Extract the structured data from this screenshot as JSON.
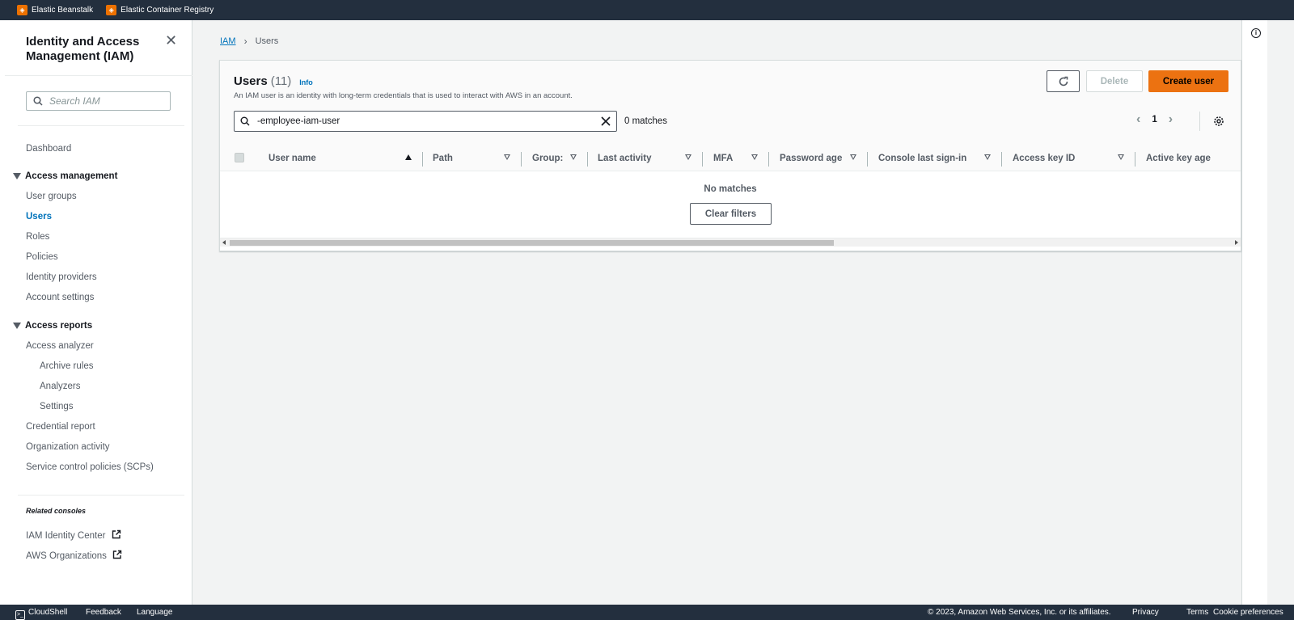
{
  "topbar": {
    "favorites": [
      {
        "label": "Elastic Beanstalk",
        "icon": "elastic-beanstalk-icon"
      },
      {
        "label": "Elastic Container Registry",
        "icon": "ecr-icon"
      }
    ]
  },
  "sidebar": {
    "title": "Identity and Access Management (IAM)",
    "search_placeholder": "Search IAM",
    "dashboard": "Dashboard",
    "access_management": {
      "label": "Access management",
      "items": [
        "User groups",
        "Users",
        "Roles",
        "Policies",
        "Identity providers",
        "Account settings"
      ]
    },
    "access_reports": {
      "label": "Access reports",
      "items": [
        "Access analyzer",
        "Archive rules",
        "Analyzers",
        "Settings",
        "Credential report",
        "Organization activity",
        "Service control policies (SCPs)"
      ]
    },
    "related_title": "Related consoles",
    "related": [
      "IAM Identity Center",
      "AWS Organizations"
    ]
  },
  "breadcrumb": {
    "root": "IAM",
    "current": "Users"
  },
  "users_panel": {
    "title": "Users",
    "count": "(11)",
    "info": "Info",
    "description": "An IAM user is an identity with long-term credentials that is used to interact with AWS in an account.",
    "delete_label": "Delete",
    "create_label": "Create user",
    "filter_value": "-employee-iam-user",
    "matches": "0 matches",
    "page": "1",
    "columns": [
      "User name",
      "Path",
      "Group:",
      "Last activity",
      "MFA",
      "Password age",
      "Console last sign-in",
      "Access key ID",
      "Active key age"
    ],
    "no_matches": "No matches",
    "clear_filters": "Clear filters"
  },
  "footer": {
    "cloudshell": "CloudShell",
    "feedback": "Feedback",
    "language": "Language",
    "copyright": "© 2023, Amazon Web Services, Inc. or its affiliates.",
    "privacy": "Privacy",
    "terms": "Terms",
    "cookie": "Cookie preferences"
  },
  "colors": {
    "nav_dark": "#232f3e",
    "accent_orange": "#ec7211",
    "link_blue": "#0073bb"
  }
}
